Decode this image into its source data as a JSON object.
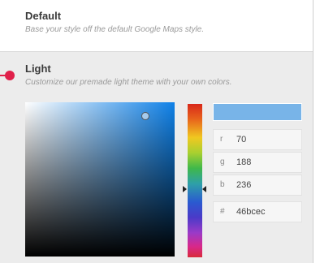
{
  "options": {
    "default": {
      "title": "Default",
      "description": "Base your style off the default Google Maps style."
    },
    "light": {
      "title": "Light",
      "description": "Customize our premade light theme with your own colors."
    }
  },
  "color_picker": {
    "current_color": "#46bcec",
    "fields": {
      "r": {
        "label": "r",
        "value": "70"
      },
      "g": {
        "label": "g",
        "value": "188"
      },
      "b": {
        "label": "b",
        "value": "236"
      },
      "hex": {
        "label": "#",
        "value": "46bcec"
      }
    }
  }
}
